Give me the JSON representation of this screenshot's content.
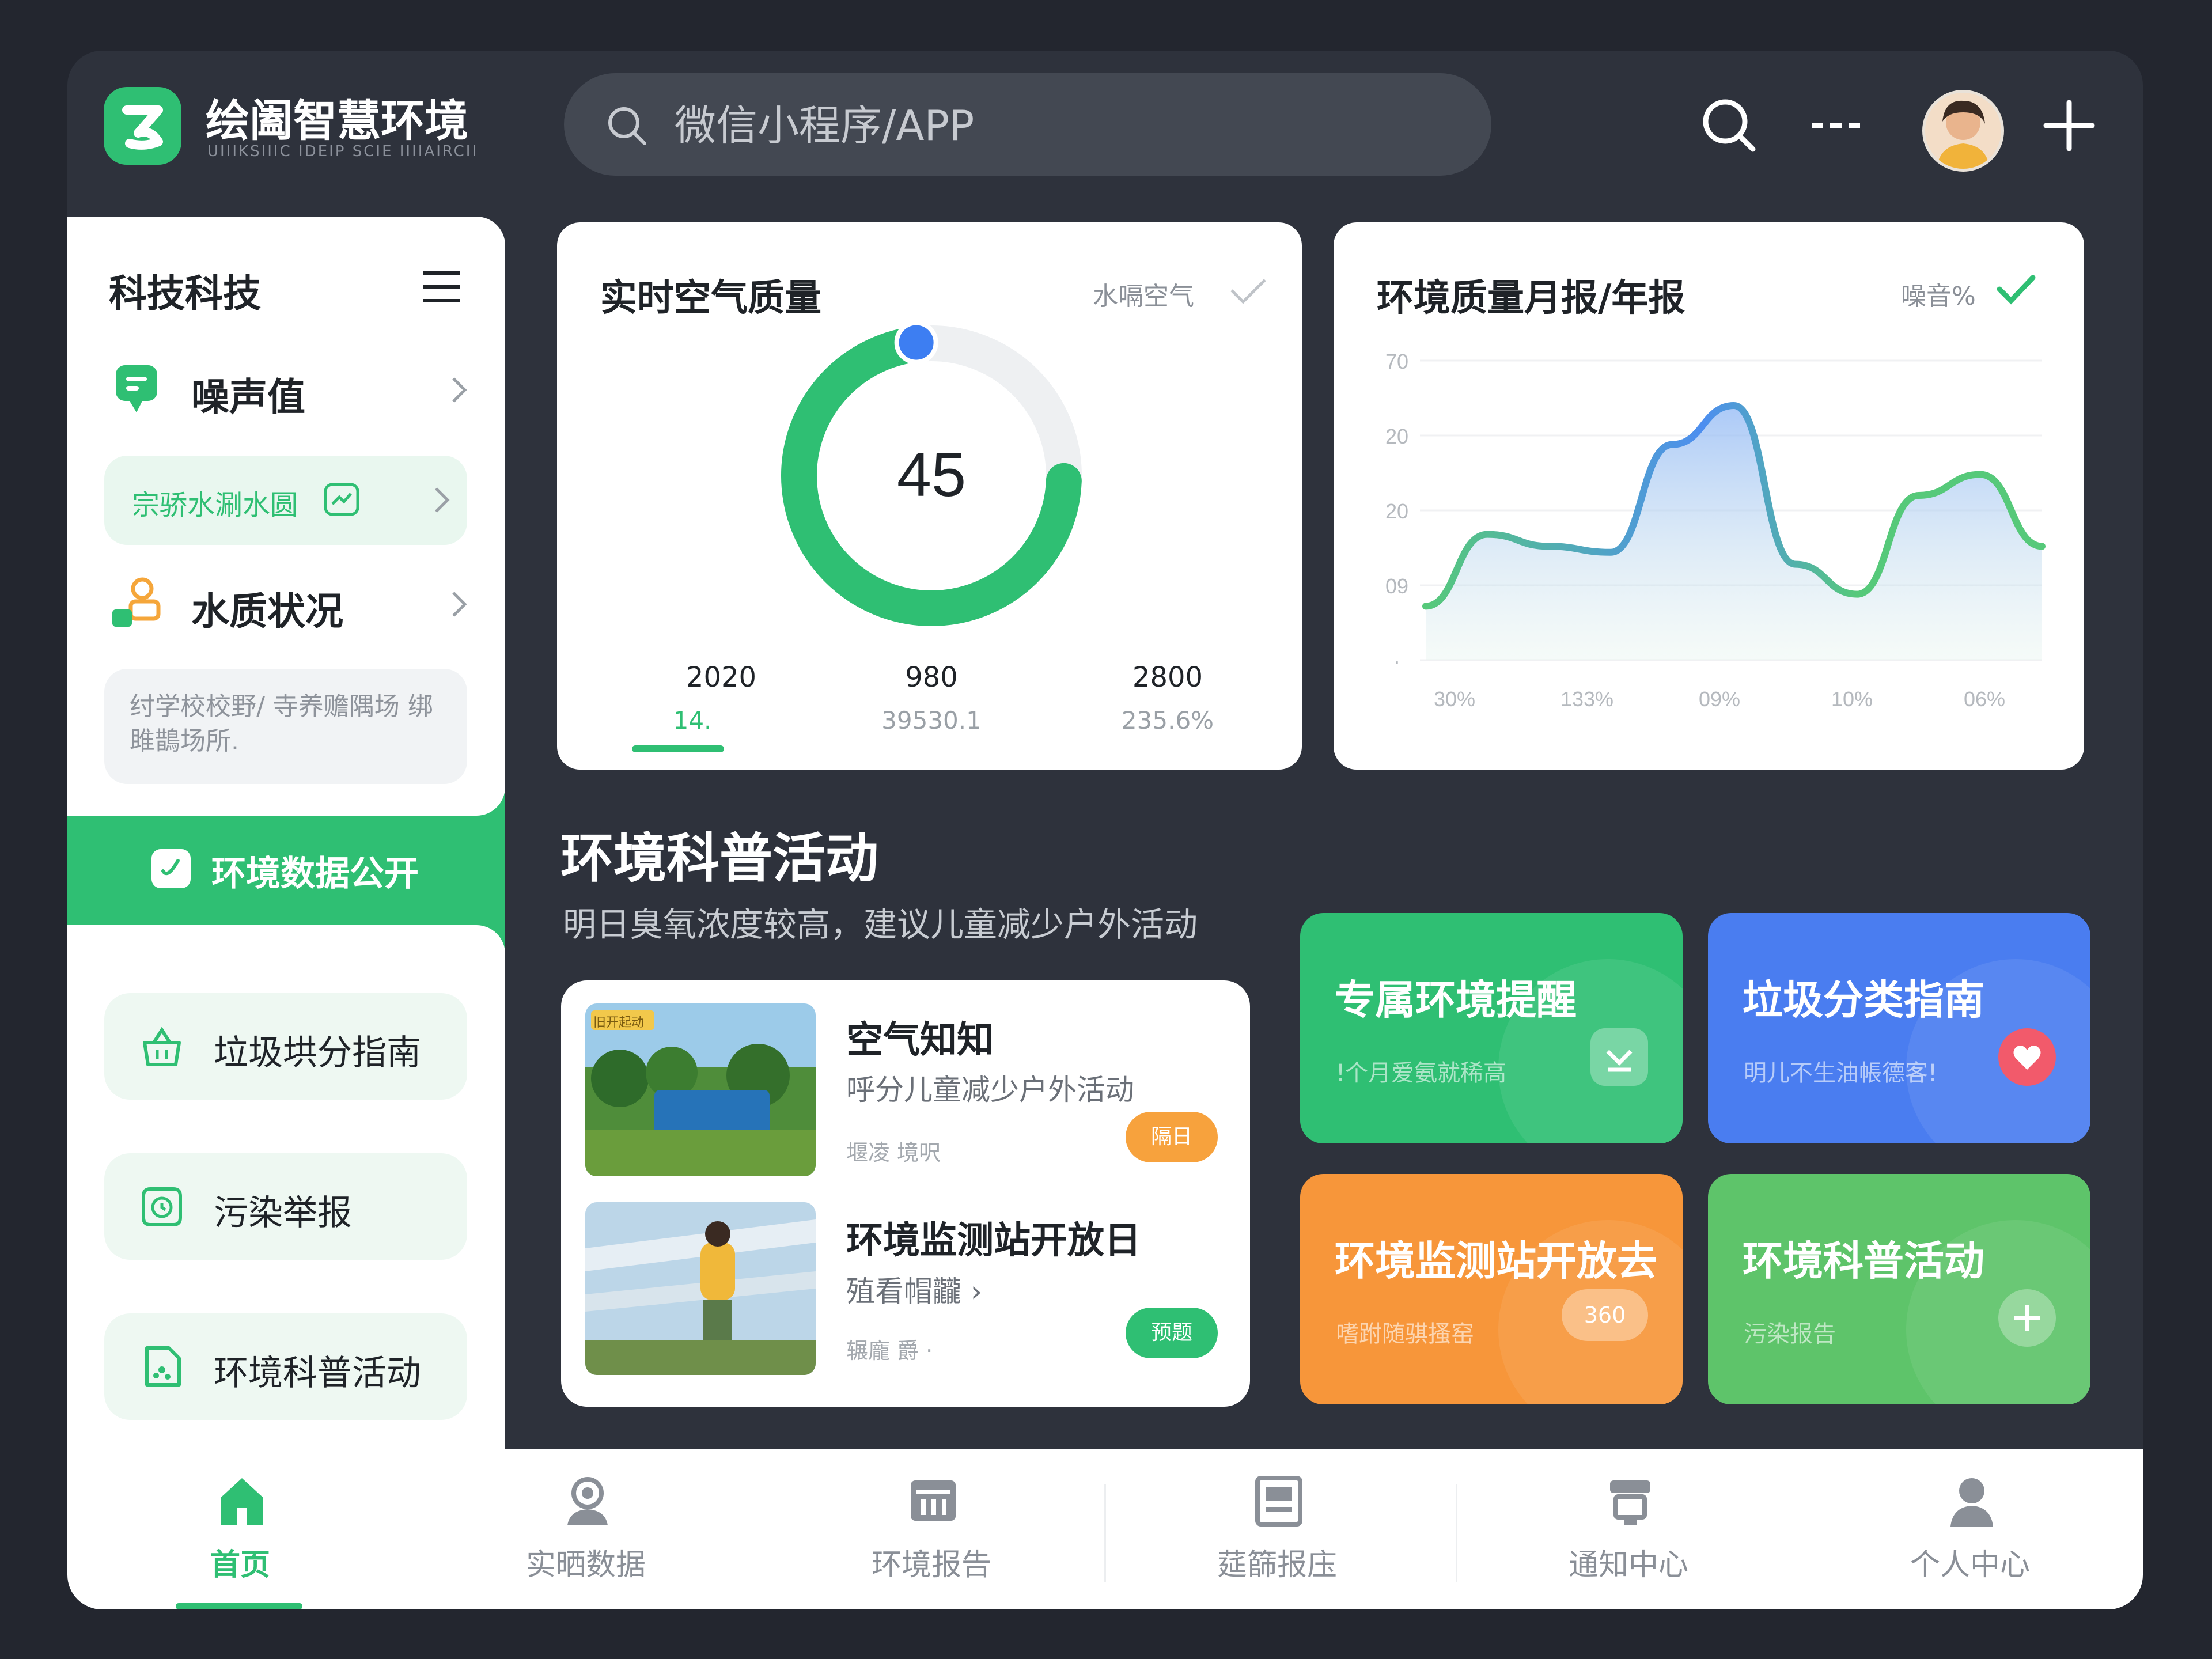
{
  "header": {
    "app_title": "绘阖智慧环境",
    "app_subtitle": "UIIIKSIIIC IDEIP SCIE IIIIAIRCII",
    "search_placeholder": "微信小程序/APP"
  },
  "sidebar": {
    "title": "科技科技",
    "noise": {
      "label": "噪声值",
      "sub_label": "宗骄水涮水圆"
    },
    "water": {
      "label": "水质状况",
      "note": "纣学校校野/ 寺养赡隅场 绑雎鵲场所."
    },
    "highlight_label": "环境数据公开",
    "buttons": [
      {
        "label": "垃圾垬分指南",
        "icon": "basket-icon"
      },
      {
        "label": "污染举报",
        "icon": "clock-report-icon"
      },
      {
        "label": "环境科普活动",
        "icon": "science-icon"
      }
    ]
  },
  "air_card": {
    "title": "实时空气质量",
    "tag": "水嗝空气",
    "gauge_value": "45",
    "gauge_fraction": 0.72,
    "stats": [
      {
        "year": "2020",
        "sub": "14."
      },
      {
        "year": "980",
        "sub": "39530.1"
      },
      {
        "year": "2800",
        "sub": "235.6%"
      }
    ]
  },
  "report_card": {
    "title": "环境质量月报/年报",
    "tag": "噪音%",
    "chart_data": {
      "type": "area",
      "y_tick_labels": [
        "70",
        "20",
        "20",
        "09",
        "·"
      ],
      "x_tick_labels": [
        "30%",
        "133%",
        "09%",
        "10%",
        "06%"
      ],
      "x": [
        0,
        0.5,
        1,
        1.5,
        2,
        2.5,
        3,
        3.5,
        4,
        4.5,
        5
      ],
      "values": [
        0.18,
        0.42,
        0.38,
        0.36,
        0.72,
        0.85,
        0.32,
        0.22,
        0.55,
        0.62,
        0.38
      ],
      "grid": true,
      "series_colors": [
        "#56c97a",
        "#4d8ef0"
      ]
    }
  },
  "section": {
    "title": "环境科普活动",
    "subtitle": "明日臭氧浓度较高，建议儿童减少户外活动"
  },
  "list": [
    {
      "title": "空气知知",
      "desc": "呼分儿童减少户外活动",
      "meta": "堰凌 境呎",
      "badge": "隔日",
      "badge_color": "#f7a23d",
      "img_tag": "旧开起动"
    },
    {
      "title": "环境监测站开放日",
      "desc": "殖看帽龖 ›",
      "meta": "辗龐 爵 ·",
      "badge": "预题",
      "badge_color": "#2fbf73"
    }
  ],
  "tiles": [
    {
      "title": "专属环境提醒",
      "sub": "!个月爱氨就稀高",
      "color": "#2fbf73"
    },
    {
      "title": "垃圾分类指南",
      "sub": "明儿不生油帳德客!",
      "color": "#4a7df0"
    },
    {
      "title": "环境监测站开放去",
      "sub": "嗜跗随骐搔窑",
      "color": "#f7963a",
      "badge": "360"
    },
    {
      "title": "环境科普活动",
      "sub": "污染报告",
      "color": "#5ec46a"
    }
  ],
  "bottom_nav": [
    {
      "label": "首页",
      "icon": "home-icon",
      "active": true
    },
    {
      "label": "实晒数据",
      "icon": "user-data-icon"
    },
    {
      "label": "环境报告",
      "icon": "report-icon"
    },
    {
      "label": "莚篩报庒",
      "icon": "document-icon"
    },
    {
      "label": "通知中心",
      "icon": "notification-icon"
    },
    {
      "label": "个人中心",
      "icon": "profile-icon"
    }
  ]
}
